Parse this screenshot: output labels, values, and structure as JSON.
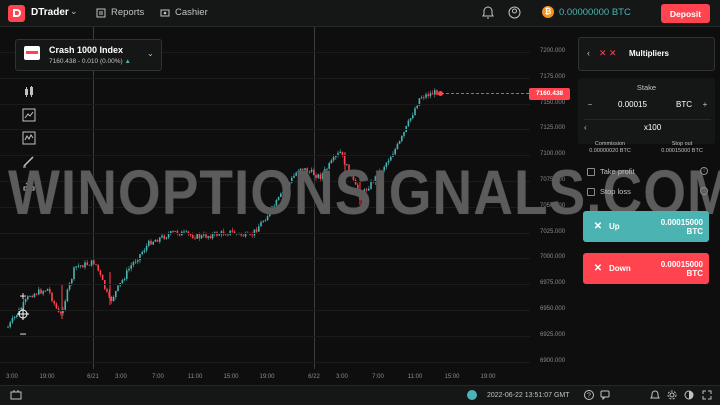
{
  "header": {
    "brand": "DTrader",
    "nav_reports": "Reports",
    "nav_cashier": "Cashier",
    "balance": "0.00000000 BTC",
    "balance_currency_icon": "bitcoin-icon",
    "deposit": "Deposit",
    "icons": [
      "bell-icon",
      "account-icon"
    ]
  },
  "symbol": {
    "name": "Crash 1000 Index",
    "quote": "7160.438 - 0.010 (0.00%)",
    "trend": "▲"
  },
  "chart": {
    "yticks": [
      "7200.000",
      "7175.000",
      "7150.000",
      "7125.000",
      "7100.000",
      "7075.000",
      "7050.000",
      "7025.000",
      "7000.000",
      "6975.000",
      "6950.000",
      "6925.000",
      "6900.000"
    ],
    "xticks": [
      "3:00",
      "19:00",
      "6/21",
      "3:00",
      "7:00",
      "11:00",
      "15:00",
      "19:00",
      "6/22",
      "3:00",
      "7:00",
      "11:00",
      "15:00",
      "19:00"
    ],
    "current_price": "7160.438",
    "colors": {
      "up": "#4bb4b3",
      "down": "#ff444f"
    }
  },
  "watermark": "WINOPTIONSIGNALS.COM",
  "trade": {
    "type": "Multipliers",
    "stake_title": "Stake",
    "stake_minus": "−",
    "stake_value": "0.00015",
    "stake_currency": "BTC",
    "stake_plus": "+",
    "multiplier": "x100",
    "commission_label": "Commission",
    "commission_value": "0.00000020 BTC",
    "stopout_label": "Stop out",
    "stopout_value": "0.00015000 BTC",
    "take_profit": "Take profit",
    "stop_loss": "Stop loss",
    "up_label": "Up",
    "up_amount": "0.00015000 BTC",
    "down_label": "Down",
    "down_amount": "0.00015000 BTC"
  },
  "footer": {
    "datetime": "2022-06-22 13:51:07 GMT"
  }
}
